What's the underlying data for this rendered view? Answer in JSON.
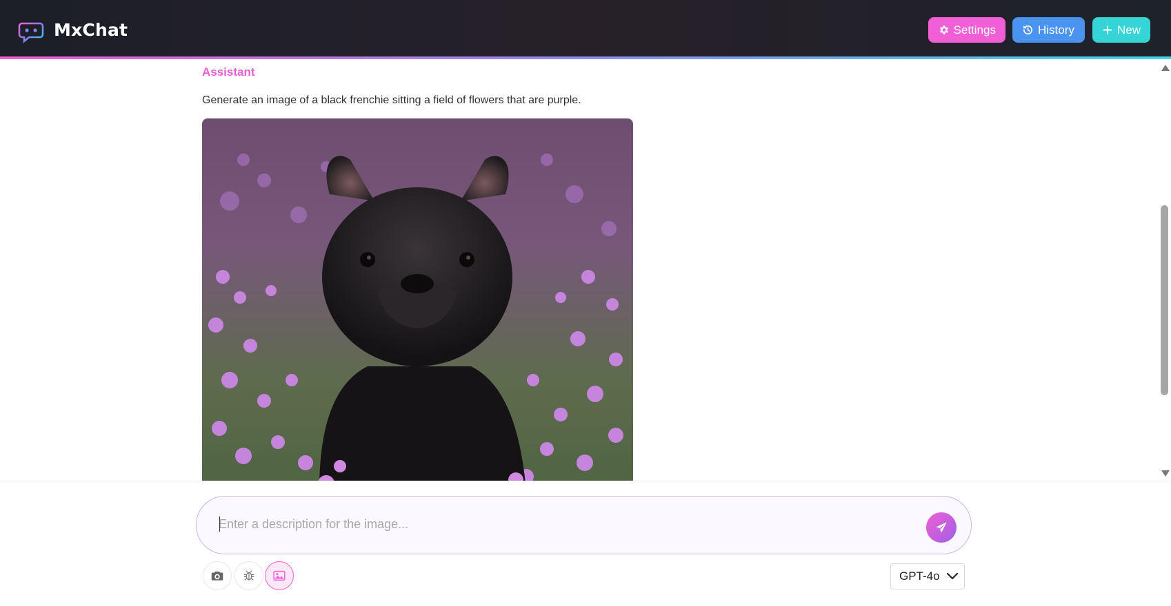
{
  "app": {
    "name": "MxChat"
  },
  "header": {
    "settings_label": "Settings",
    "history_label": "History",
    "new_label": "New"
  },
  "chat": {
    "sender": "Assistant",
    "message": "Generate an image of a black frenchie sitting a field of flowers that are purple."
  },
  "composer": {
    "placeholder": "Enter a description for the image...",
    "value": "",
    "tools": [
      "camera-icon",
      "bug-icon",
      "image-icon"
    ],
    "model": "GPT-4o"
  },
  "colors": {
    "settings": "#f05fd6",
    "history": "#4a93ee",
    "new": "#35d4d6",
    "accent": "#e85fd4"
  }
}
